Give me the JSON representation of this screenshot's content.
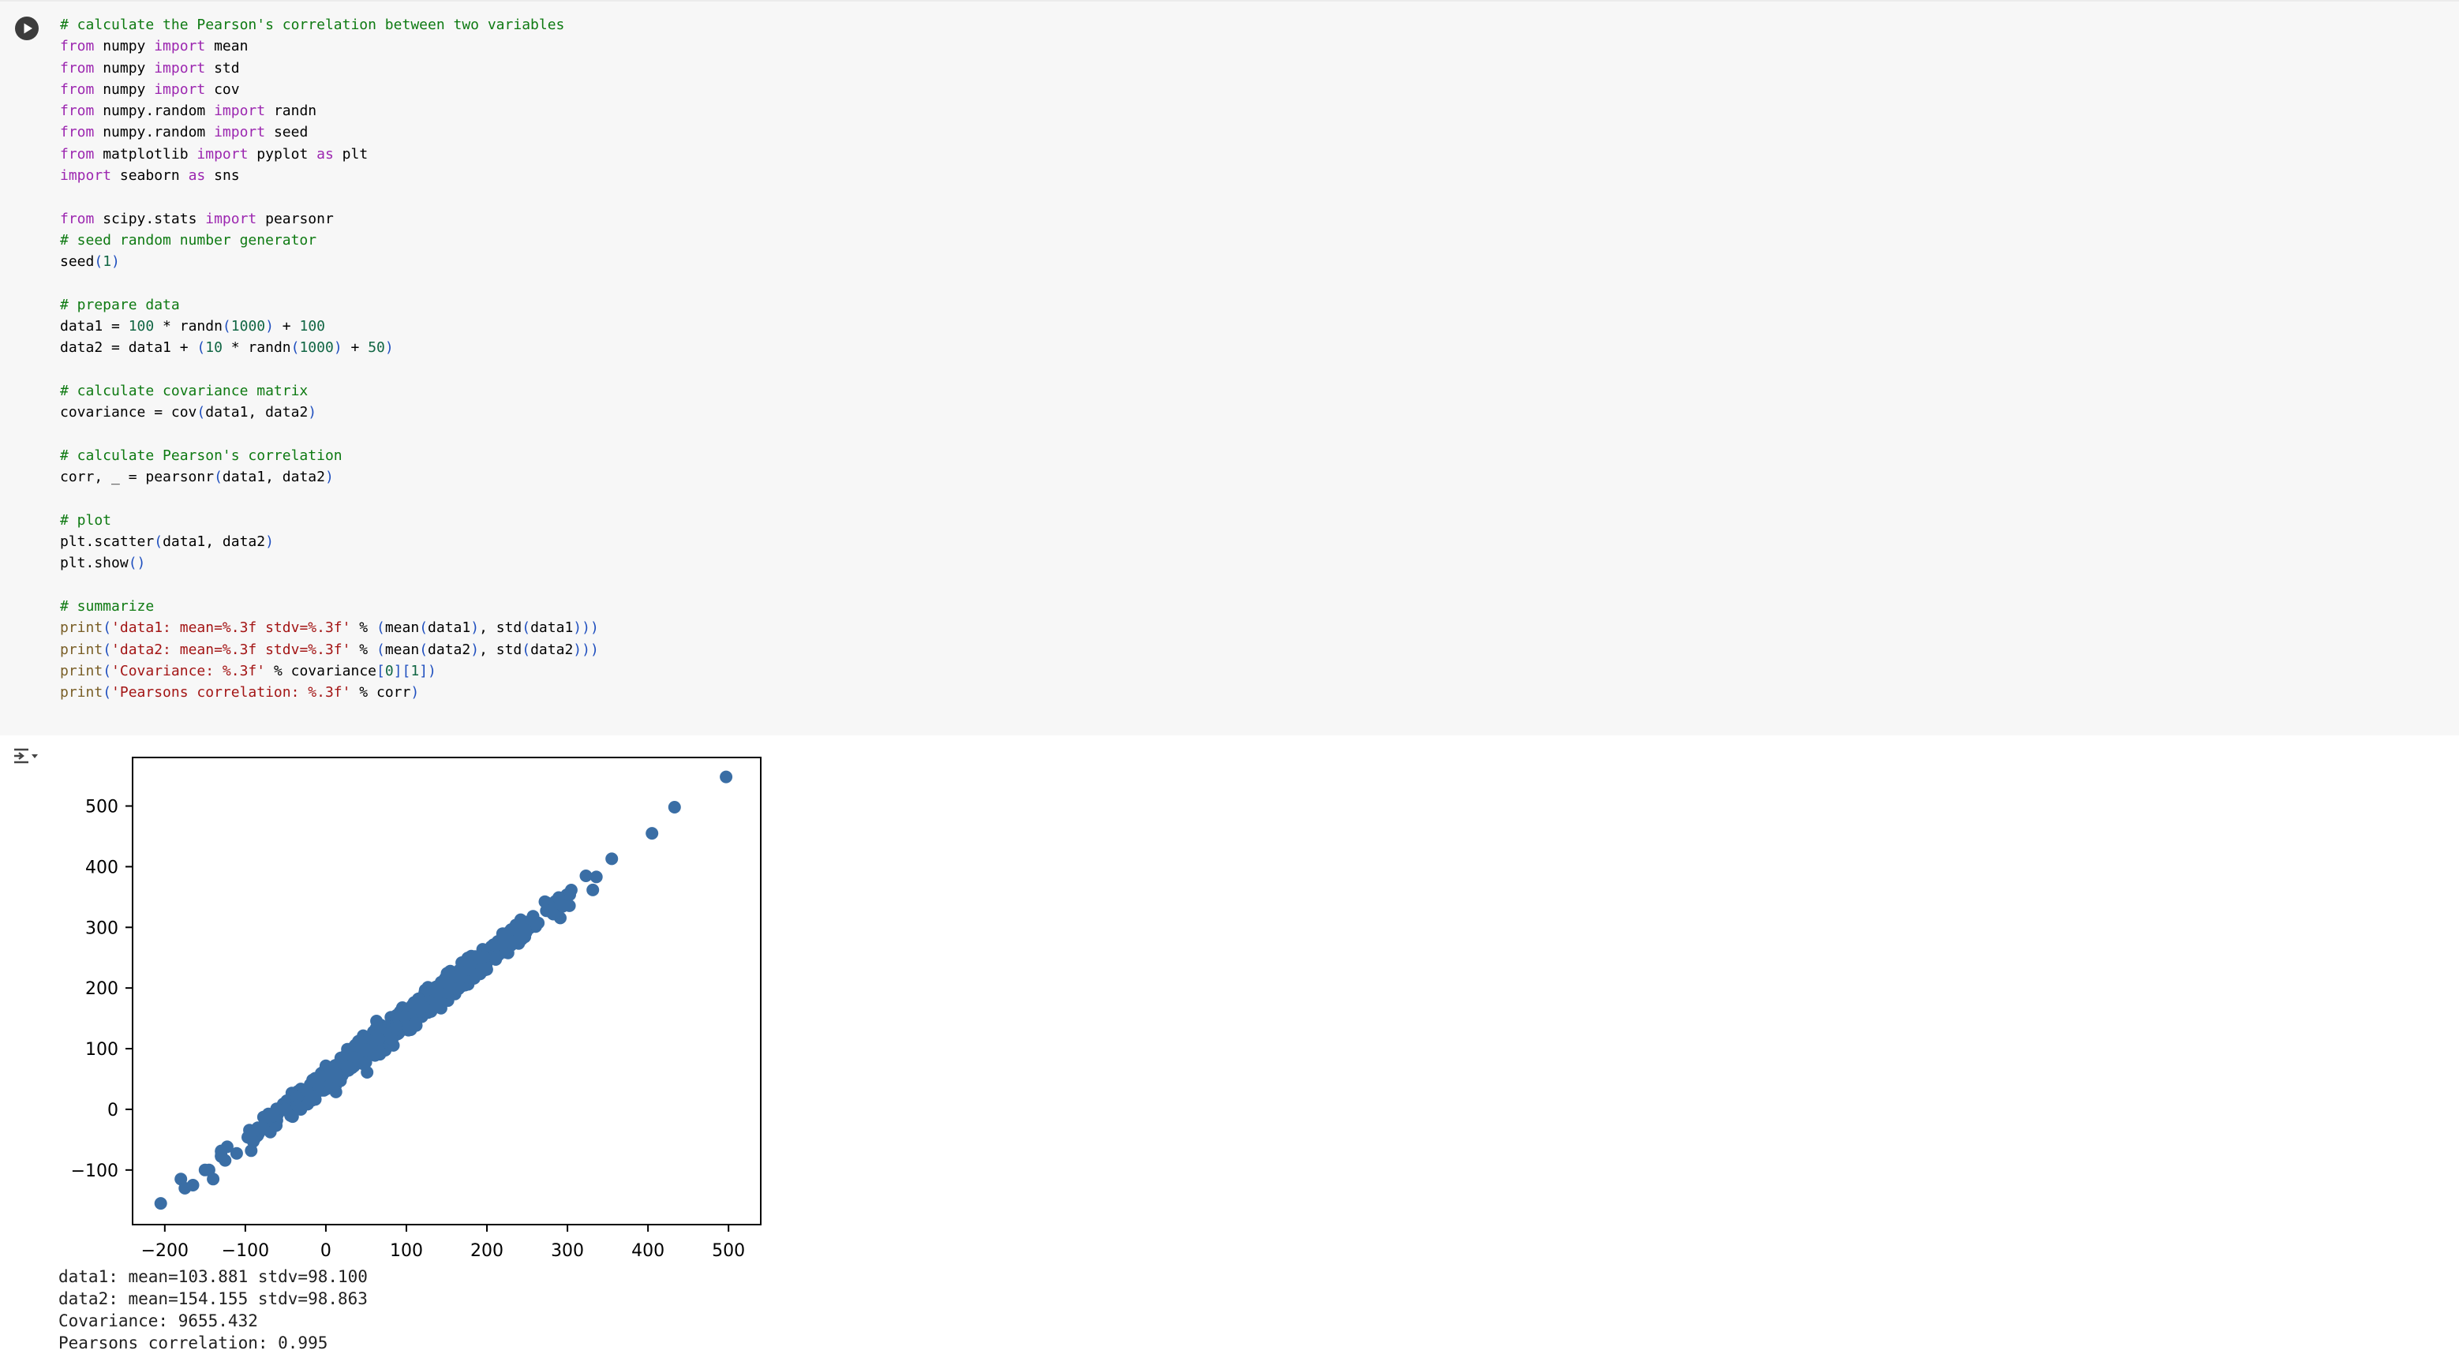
{
  "code_lines": [
    [
      [
        "com",
        "# calculate the Pearson's correlation between two variables"
      ]
    ],
    [
      [
        "kw",
        "from"
      ],
      [
        "plain",
        " numpy "
      ],
      [
        "kw",
        "import"
      ],
      [
        "plain",
        " mean"
      ]
    ],
    [
      [
        "kw",
        "from"
      ],
      [
        "plain",
        " numpy "
      ],
      [
        "kw",
        "import"
      ],
      [
        "plain",
        " std"
      ]
    ],
    [
      [
        "kw",
        "from"
      ],
      [
        "plain",
        " numpy "
      ],
      [
        "kw",
        "import"
      ],
      [
        "plain",
        " cov"
      ]
    ],
    [
      [
        "kw",
        "from"
      ],
      [
        "plain",
        " numpy.random "
      ],
      [
        "kw",
        "import"
      ],
      [
        "plain",
        " randn"
      ]
    ],
    [
      [
        "kw",
        "from"
      ],
      [
        "plain",
        " numpy.random "
      ],
      [
        "kw",
        "import"
      ],
      [
        "plain",
        " seed"
      ]
    ],
    [
      [
        "kw",
        "from"
      ],
      [
        "plain",
        " matplotlib "
      ],
      [
        "kw",
        "import"
      ],
      [
        "plain",
        " pyplot "
      ],
      [
        "kw",
        "as"
      ],
      [
        "plain",
        " plt"
      ]
    ],
    [
      [
        "kw",
        "import"
      ],
      [
        "plain",
        " seaborn "
      ],
      [
        "kw",
        "as"
      ],
      [
        "plain",
        " sns"
      ]
    ],
    [],
    [
      [
        "kw",
        "from"
      ],
      [
        "plain",
        " scipy.stats "
      ],
      [
        "kw",
        "import"
      ],
      [
        "plain",
        " pearsonr"
      ]
    ],
    [
      [
        "com",
        "# seed random number generator"
      ]
    ],
    [
      [
        "plain",
        "seed"
      ],
      [
        "br",
        "("
      ],
      [
        "num",
        "1"
      ],
      [
        "br",
        ")"
      ]
    ],
    [],
    [
      [
        "com",
        "# prepare data"
      ]
    ],
    [
      [
        "plain",
        "data1 = "
      ],
      [
        "num",
        "100"
      ],
      [
        "plain",
        " * randn"
      ],
      [
        "br",
        "("
      ],
      [
        "num",
        "1000"
      ],
      [
        "br",
        ")"
      ],
      [
        "plain",
        " + "
      ],
      [
        "num",
        "100"
      ]
    ],
    [
      [
        "plain",
        "data2 = data1 + "
      ],
      [
        "br",
        "("
      ],
      [
        "num",
        "10"
      ],
      [
        "plain",
        " * randn"
      ],
      [
        "br",
        "("
      ],
      [
        "num",
        "1000"
      ],
      [
        "br",
        ")"
      ],
      [
        "plain",
        " + "
      ],
      [
        "num",
        "50"
      ],
      [
        "br",
        ")"
      ]
    ],
    [],
    [
      [
        "com",
        "# calculate covariance matrix"
      ]
    ],
    [
      [
        "plain",
        "covariance = cov"
      ],
      [
        "br",
        "("
      ],
      [
        "plain",
        "data1, data2"
      ],
      [
        "br",
        ")"
      ]
    ],
    [],
    [
      [
        "com",
        "# calculate Pearson's correlation"
      ]
    ],
    [
      [
        "plain",
        "corr, _ = pearsonr"
      ],
      [
        "br",
        "("
      ],
      [
        "plain",
        "data1, data2"
      ],
      [
        "br",
        ")"
      ]
    ],
    [],
    [
      [
        "com",
        "# plot"
      ]
    ],
    [
      [
        "plain",
        "plt.scatter"
      ],
      [
        "br",
        "("
      ],
      [
        "plain",
        "data1, data2"
      ],
      [
        "br",
        ")"
      ]
    ],
    [
      [
        "plain",
        "plt.show"
      ],
      [
        "br",
        "()"
      ]
    ],
    [],
    [
      [
        "com",
        "# summarize"
      ]
    ],
    [
      [
        "fn",
        "print"
      ],
      [
        "br",
        "("
      ],
      [
        "str",
        "'data1: mean=%.3f stdv=%.3f'"
      ],
      [
        "plain",
        " % "
      ],
      [
        "br",
        "("
      ],
      [
        "plain",
        "mean"
      ],
      [
        "br",
        "("
      ],
      [
        "plain",
        "data1"
      ],
      [
        "br",
        ")"
      ],
      [
        "plain",
        ", std"
      ],
      [
        "br",
        "("
      ],
      [
        "plain",
        "data1"
      ],
      [
        "br",
        ")))"
      ]
    ],
    [
      [
        "fn",
        "print"
      ],
      [
        "br",
        "("
      ],
      [
        "str",
        "'data2: mean=%.3f stdv=%.3f'"
      ],
      [
        "plain",
        " % "
      ],
      [
        "br",
        "("
      ],
      [
        "plain",
        "mean"
      ],
      [
        "br",
        "("
      ],
      [
        "plain",
        "data2"
      ],
      [
        "br",
        ")"
      ],
      [
        "plain",
        ", std"
      ],
      [
        "br",
        "("
      ],
      [
        "plain",
        "data2"
      ],
      [
        "br",
        ")))"
      ]
    ],
    [
      [
        "fn",
        "print"
      ],
      [
        "br",
        "("
      ],
      [
        "str",
        "'Covariance: %.3f'"
      ],
      [
        "plain",
        " % covariance"
      ],
      [
        "br",
        "["
      ],
      [
        "num",
        "0"
      ],
      [
        "br",
        "]["
      ],
      [
        "num",
        "1"
      ],
      [
        "br",
        "])"
      ]
    ],
    [
      [
        "fn",
        "print"
      ],
      [
        "br",
        "("
      ],
      [
        "str",
        "'Pearsons correlation: %.3f'"
      ],
      [
        "plain",
        " % corr"
      ],
      [
        "br",
        ")"
      ]
    ]
  ],
  "chart_data": {
    "type": "scatter",
    "title": "",
    "xlabel": "",
    "ylabel": "",
    "xlim": [
      -240,
      540
    ],
    "ylim": [
      -190,
      580
    ],
    "xticks": [
      -200,
      -100,
      0,
      100,
      200,
      300,
      400,
      500
    ],
    "yticks": [
      -100,
      0,
      100,
      200,
      300,
      400,
      500
    ],
    "xtick_labels": [
      "−200",
      "−100",
      "0",
      "100",
      "200",
      "300",
      "400",
      "500"
    ],
    "ytick_labels": [
      "−100",
      "0",
      "100",
      "200",
      "300",
      "400",
      "500"
    ],
    "grid": false,
    "legend": "none",
    "marker_color": "#3a6ea5",
    "n_points": 1000,
    "slope_est": 1.0,
    "intercept_est": 50,
    "noise_sd_est": 10,
    "outliers": [
      {
        "x": -205,
        "y": -155
      },
      {
        "x": -180,
        "y": -115
      },
      {
        "x": -175,
        "y": -130
      },
      {
        "x": -165,
        "y": -125
      },
      {
        "x": -150,
        "y": -100
      },
      {
        "x": -145,
        "y": -100
      },
      {
        "x": -140,
        "y": -115
      },
      {
        "x": 405,
        "y": 455
      },
      {
        "x": 433,
        "y": 498
      },
      {
        "x": 497,
        "y": 548
      }
    ]
  },
  "stdout": [
    "data1: mean=103.881 stdv=98.100",
    "data2: mean=154.155 stdv=98.863",
    "Covariance: 9655.432",
    "Pearsons correlation: 0.995"
  ]
}
